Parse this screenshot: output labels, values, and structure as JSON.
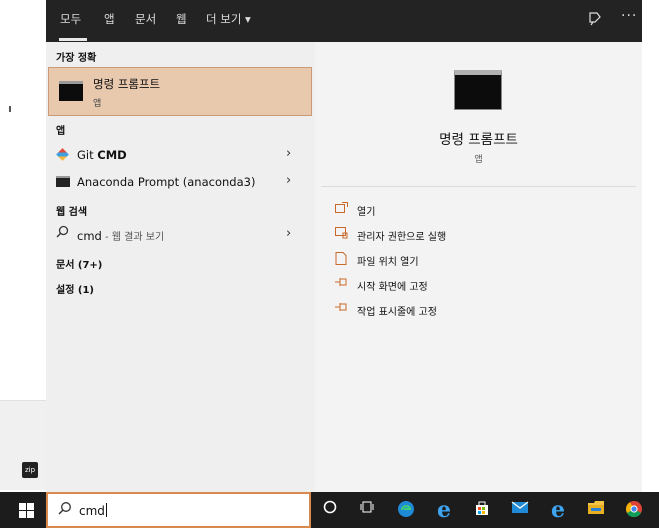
{
  "tabs": [
    {
      "label": "모두"
    },
    {
      "label": "앱"
    },
    {
      "label": "문서"
    },
    {
      "label": "웹"
    },
    {
      "label": "더 보기 ▾"
    }
  ],
  "sections": {
    "best_match": "가장 정확",
    "apps": "앱",
    "web_search": "웹 검색",
    "documents": "문서 (7+)",
    "settings": "설정 (1)"
  },
  "best_match": {
    "title": "명령 프롬프트",
    "subtitle": "앱"
  },
  "apps": [
    {
      "name_plain": "Git ",
      "name_bold": "CMD"
    },
    {
      "name_plain": "Anaconda Prompt (anaconda3)",
      "name_bold": ""
    }
  ],
  "web_search": {
    "query": "cmd",
    "hint": " - 웹 결과 보기"
  },
  "detail": {
    "title": "명령 프롬프트",
    "subtitle": "앱",
    "actions": [
      {
        "label": "열기",
        "icon": "open-icon"
      },
      {
        "label": "관리자 권한으로 실행",
        "icon": "admin-shield-icon"
      },
      {
        "label": "파일 위치 열기",
        "icon": "file-location-icon"
      },
      {
        "label": "시작 화면에 고정",
        "icon": "pin-icon"
      },
      {
        "label": "작업 표시줄에 고정",
        "icon": "pin-icon"
      }
    ]
  },
  "taskbar": {
    "search_value": "cmd",
    "icons": [
      "cortana-icon",
      "task-view-icon",
      "edge-icon",
      "ie-icon",
      "store-icon",
      "mail-icon",
      "ie-icon",
      "file-explorer-icon",
      "chrome-icon"
    ]
  },
  "colors": {
    "accent": "#e8c9ae",
    "accent_border": "#c99a73",
    "topbar": "#232323",
    "taskbar": "#1c1c1c"
  }
}
